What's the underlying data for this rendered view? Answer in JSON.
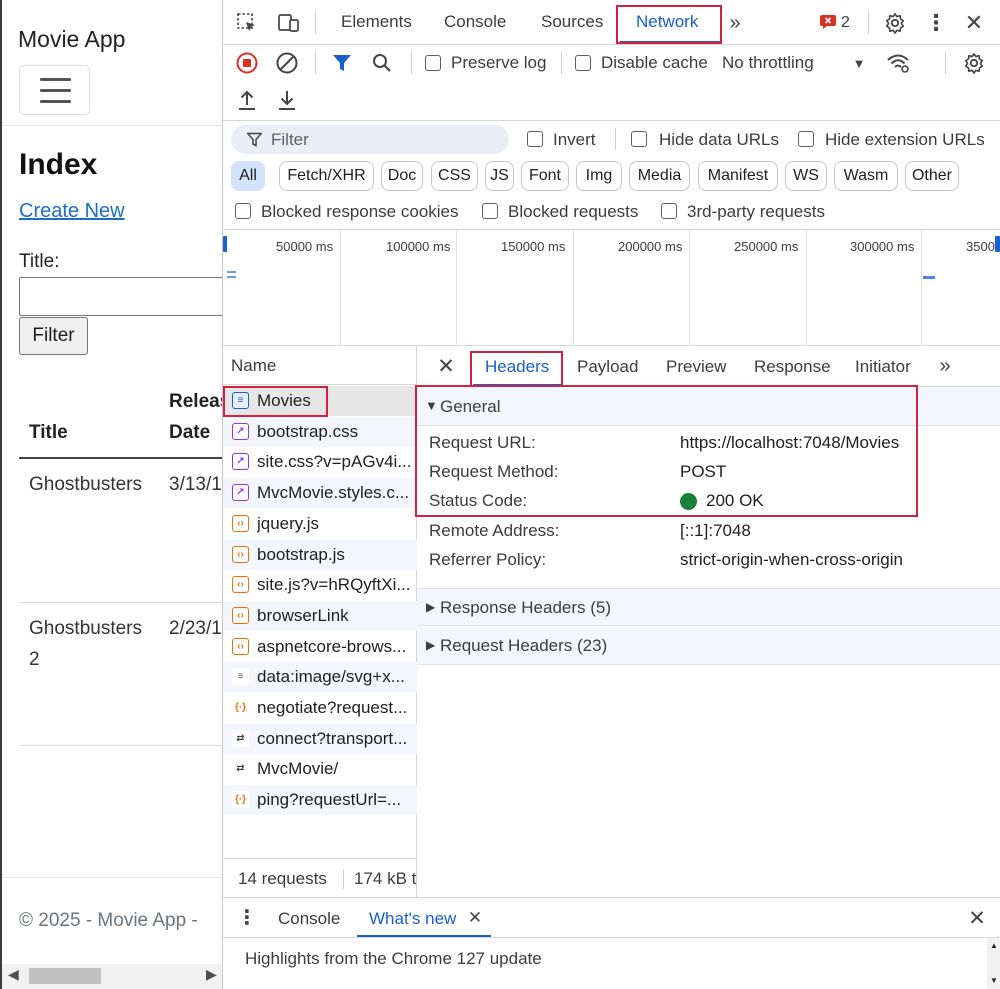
{
  "webpage": {
    "brand": "Movie App",
    "heading": "Index",
    "create_link": "Create New",
    "title_label": "Title:",
    "filter_button": "Filter",
    "columns": {
      "title": "Title",
      "release_1": "Releas",
      "release_2": "Date"
    },
    "rows": [
      {
        "title_1": "Ghostbusters",
        "title_2": "",
        "date": "3/13/1"
      },
      {
        "title_1": "Ghostbusters",
        "title_2": "2",
        "date": "2/23/1"
      }
    ],
    "footer": "© 2025 - Movie App -"
  },
  "devtools": {
    "main_tabs": [
      "Elements",
      "Console",
      "Sources",
      "Network"
    ],
    "active_main_tab": "Network",
    "issues_count": "2",
    "toolbar": {
      "preserve_log": "Preserve log",
      "disable_cache": "Disable cache",
      "throttling": "No throttling"
    },
    "filter": {
      "placeholder": "Filter",
      "invert": "Invert",
      "hide_data_urls": "Hide data URLs",
      "hide_extension_urls": "Hide extension URLs"
    },
    "type_chips": [
      "All",
      "Fetch/XHR",
      "Doc",
      "CSS",
      "JS",
      "Font",
      "Img",
      "Media",
      "Manifest",
      "WS",
      "Wasm",
      "Other"
    ],
    "extra_filters": {
      "blocked_cookies": "Blocked response cookies",
      "blocked_requests": "Blocked requests",
      "third_party": "3rd-party requests"
    },
    "timeline_labels": [
      "50000 ms",
      "100000 ms",
      "150000 ms",
      "200000 ms",
      "250000 ms",
      "300000 ms",
      "3500"
    ],
    "name_header": "Name",
    "requests": [
      {
        "name": "Movies",
        "kind": "doc"
      },
      {
        "name": "bootstrap.css",
        "kind": "css"
      },
      {
        "name": "site.css?v=pAGv4i...",
        "kind": "css"
      },
      {
        "name": "MvcMovie.styles.c...",
        "kind": "css"
      },
      {
        "name": "jquery.js",
        "kind": "js"
      },
      {
        "name": "bootstrap.js",
        "kind": "js"
      },
      {
        "name": "site.js?v=hRQyftXi...",
        "kind": "js"
      },
      {
        "name": "browserLink",
        "kind": "js"
      },
      {
        "name": "aspnetcore-brows...",
        "kind": "js"
      },
      {
        "name": "data:image/svg+x...",
        "kind": "img"
      },
      {
        "name": "negotiate?request...",
        "kind": "fetch"
      },
      {
        "name": "connect?transport...",
        "kind": "ws"
      },
      {
        "name": "MvcMovie/",
        "kind": "ws"
      },
      {
        "name": "ping?requestUrl=...",
        "kind": "fetch"
      }
    ],
    "summary": {
      "requests": "14 requests",
      "size": "174 kB t"
    },
    "detail_tabs": [
      "Headers",
      "Payload",
      "Preview",
      "Response",
      "Initiator"
    ],
    "active_detail_tab": "Headers",
    "general": {
      "title": "General",
      "fields": [
        {
          "key": "Request URL:",
          "value": "https://localhost:7048/Movies"
        },
        {
          "key": "Request Method:",
          "value": "POST"
        },
        {
          "key": "Status Code:",
          "value": "200 OK"
        },
        {
          "key": "Remote Address:",
          "value": "[::1]:7048"
        },
        {
          "key": "Referrer Policy:",
          "value": "strict-origin-when-cross-origin"
        }
      ]
    },
    "response_headers": "Response Headers (5)",
    "request_headers": "Request Headers (23)",
    "drawer": {
      "tabs": [
        "Console",
        "What's new"
      ],
      "active_tab": "What's new",
      "message": "Highlights from the Chrome 127 update"
    },
    "colors": {
      "accent": "#1a5fd0",
      "highlight_box": "#d3213f",
      "status_ok": "#188038"
    }
  }
}
